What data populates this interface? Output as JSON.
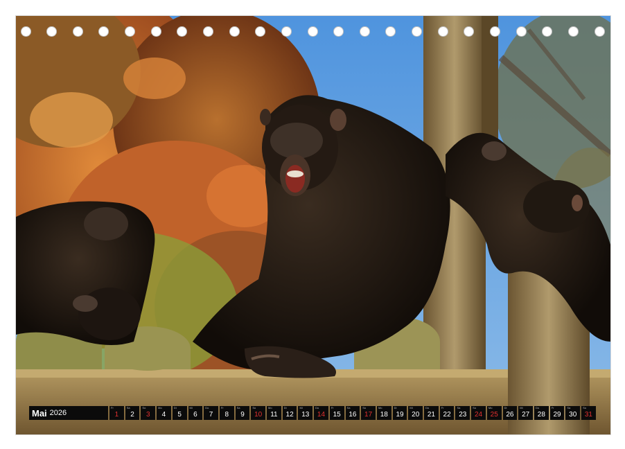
{
  "calendar": {
    "month": "Mai",
    "year": "2026",
    "days": [
      {
        "n": "1",
        "wd": "Fr",
        "red": true
      },
      {
        "n": "2",
        "wd": "Sa",
        "red": false
      },
      {
        "n": "3",
        "wd": "So",
        "red": true
      },
      {
        "n": "4",
        "wd": "Mo",
        "red": false
      },
      {
        "n": "5",
        "wd": "Di",
        "red": false
      },
      {
        "n": "6",
        "wd": "Mi",
        "red": false
      },
      {
        "n": "7",
        "wd": "Do",
        "red": false
      },
      {
        "n": "8",
        "wd": "Fr",
        "red": false
      },
      {
        "n": "9",
        "wd": "Sa",
        "red": false
      },
      {
        "n": "10",
        "wd": "So",
        "red": true
      },
      {
        "n": "11",
        "wd": "Mo",
        "red": false
      },
      {
        "n": "12",
        "wd": "Di",
        "red": false
      },
      {
        "n": "13",
        "wd": "Mi",
        "red": false
      },
      {
        "n": "14",
        "wd": "Do",
        "red": true
      },
      {
        "n": "15",
        "wd": "Fr",
        "red": false
      },
      {
        "n": "16",
        "wd": "Sa",
        "red": false
      },
      {
        "n": "17",
        "wd": "So",
        "red": true
      },
      {
        "n": "18",
        "wd": "Mo",
        "red": false
      },
      {
        "n": "19",
        "wd": "Di",
        "red": false
      },
      {
        "n": "20",
        "wd": "Mi",
        "red": false
      },
      {
        "n": "21",
        "wd": "Do",
        "red": false
      },
      {
        "n": "22",
        "wd": "Fr",
        "red": false
      },
      {
        "n": "23",
        "wd": "Sa",
        "red": false
      },
      {
        "n": "24",
        "wd": "So",
        "red": true
      },
      {
        "n": "25",
        "wd": "Mo",
        "red": true
      },
      {
        "n": "26",
        "wd": "Di",
        "red": false
      },
      {
        "n": "27",
        "wd": "Mi",
        "red": false
      },
      {
        "n": "28",
        "wd": "Do",
        "red": false
      },
      {
        "n": "29",
        "wd": "Fr",
        "red": false
      },
      {
        "n": "30",
        "wd": "Sa",
        "red": false
      },
      {
        "n": "31",
        "wd": "So",
        "red": true
      }
    ]
  },
  "binding_hole_count": 23,
  "colors": {
    "sky": "#5f9fe0",
    "foliage_orange": "#c8642a",
    "foliage_green": "#8aa03a",
    "chimp_fur": "#1c1510",
    "wood": "#9a7d4a",
    "holiday_text": "#e23030"
  }
}
